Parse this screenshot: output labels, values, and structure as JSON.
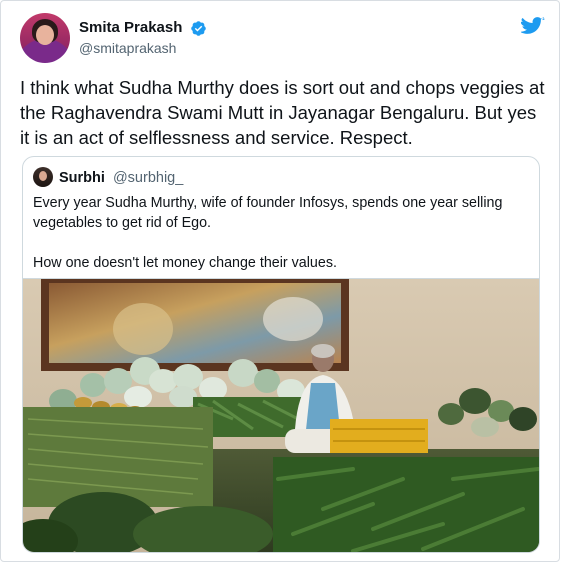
{
  "tweet": {
    "author": {
      "display_name": "Smita Prakash",
      "handle": "@smitaprakash",
      "verified_icon": "verified-badge-icon",
      "avatar_icon": "profile-photo"
    },
    "text": "I think what Sudha Murthy does is sort out and chops veggies at the Raghavendra Swami Mutt in Jayanagar Bengaluru. But yes it is an act of selflessness and service. Respect.",
    "platform_icon": "twitter-bird-icon"
  },
  "quoted_tweet": {
    "author": {
      "display_name": "Surbhi",
      "handle": "@surbhig_"
    },
    "text_line_1": "Every year Sudha Murthy, wife of founder Infosys, spends one year selling vegetables to get rid of Ego.",
    "text_line_2": "How one doesn't let money change their values."
  },
  "colors": {
    "text": "#0f1419",
    "secondary": "#536471",
    "twitter_blue": "#1d9bf0",
    "border": "#cfd9de"
  }
}
